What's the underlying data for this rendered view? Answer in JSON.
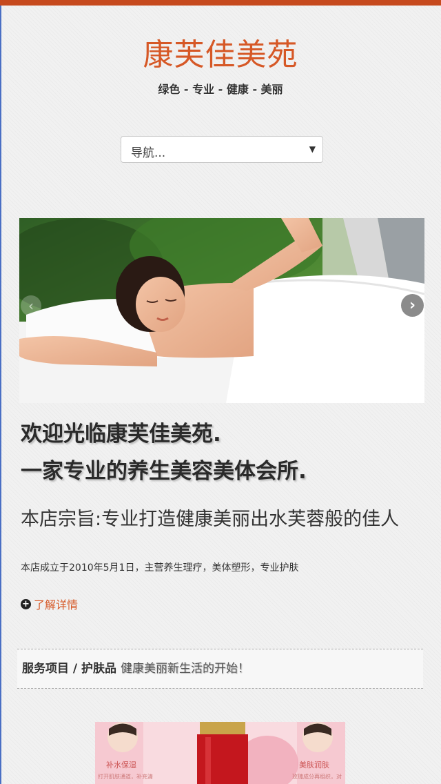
{
  "header": {
    "site_title": "康芙佳美苑",
    "tagline": "绿色 - 专业 - 健康 - 美丽"
  },
  "nav": {
    "placeholder": "导航...",
    "caret_icon": "triangle-down"
  },
  "slider": {
    "prev_icon": "chevron-left",
    "next_icon": "chevron-right"
  },
  "welcome": {
    "line1": "欢迎光临康芙佳美苑.",
    "line2": "一家专业的养生美容美体会所.",
    "motto": "本店宗旨:专业打造健康美丽出水芙蓉般的佳人",
    "intro": "本店成立于2010年5月1日，主营养生理疗，美体塑形，专业护肤",
    "more_label": "了解详情",
    "more_icon": "plus-circle"
  },
  "services": {
    "category": "服务项目",
    "separator": " / ",
    "category2": "护肤品",
    "slogan": "健康美丽新生活的开始！"
  },
  "product_banner": {
    "left_label": "补水保湿",
    "right_label": "美肤润肤",
    "left_small": "打开肌肤通道，补充清",
    "right_small": "玫瑰成分再组织，对"
  },
  "colors": {
    "accent": "#d65826",
    "top_bar": "#c64a1e"
  }
}
